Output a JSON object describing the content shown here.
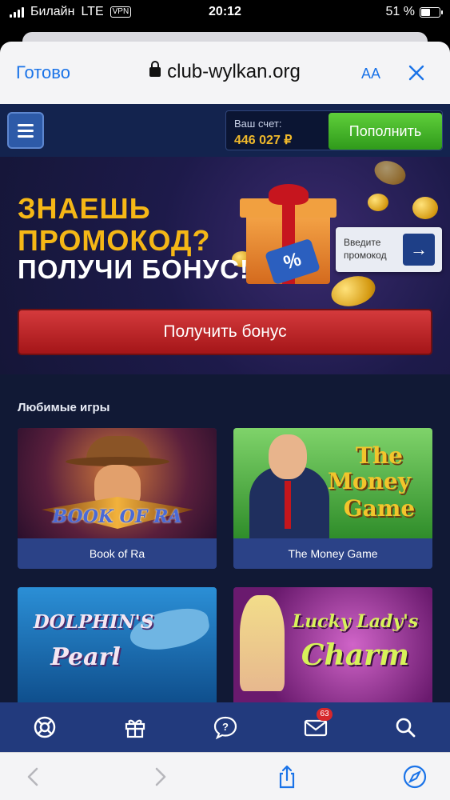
{
  "status_bar": {
    "carrier": "Билайн",
    "network": "LTE",
    "vpn": "VPN",
    "time": "20:12",
    "battery": "51 %",
    "battery_level": 0.51
  },
  "browser": {
    "done_label": "Готово",
    "url": "club-wylkan.org",
    "text_size_label": "AA",
    "close_icon": "close-icon",
    "load_progress": 0.4
  },
  "header": {
    "menu_icon": "hamburger-icon",
    "account_label": "Ваш счет:",
    "account_value": "446 027 ₽",
    "topup_label": "Пополнить"
  },
  "promo": {
    "line1": "ЗНАЕШЬ",
    "line2": "ПРОМОКОД?",
    "line3": "ПОЛУЧИ БОНУС!",
    "tag": "%",
    "input_label": "Введите промокод",
    "input_button": "→",
    "bonus_button": "Получить бонус"
  },
  "games": {
    "title": "Любимые игры",
    "items": [
      {
        "label": "Book of Ra",
        "art": "BOOK OF RA"
      },
      {
        "label": "The Money Game",
        "art1": "The",
        "art2": "Money",
        "art3": "Game"
      },
      {
        "label": "Dolphin's Pearl",
        "art1": "DOLPHIN'S",
        "art2": "Pearl"
      },
      {
        "label": "Lucky Lady's Charm",
        "art1": "Lucky Lady's",
        "art2": "Charm"
      }
    ]
  },
  "bottom_nav": {
    "items": [
      "lifebuoy-icon",
      "gift-icon",
      "chat-icon",
      "mail-icon",
      "search-icon"
    ],
    "mail_badge": "63"
  },
  "toolbar": {
    "items": [
      "back-icon",
      "forward-icon",
      "share-icon",
      "compass-icon"
    ]
  },
  "colors": {
    "accent": "#1a73e8",
    "promo_gold": "#f5b716",
    "topup_green": "#3bad24",
    "bonus_red": "#c0272b",
    "nav_blue": "#223a7d",
    "balance_gold": "#f0b92b"
  }
}
